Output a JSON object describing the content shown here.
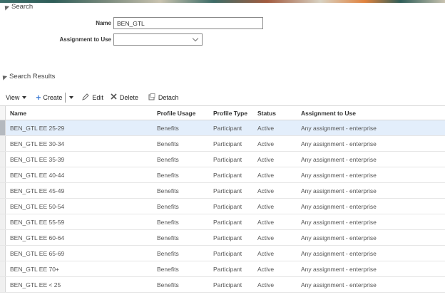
{
  "search": {
    "title": "Search",
    "name_label": "Name",
    "name_value": "BEN_GTL",
    "assignment_label": "Assignment to Use",
    "assignment_value": ""
  },
  "results": {
    "title": "Search Results",
    "toolbar": {
      "view_label": "View",
      "create_label": "Create",
      "edit_label": "Edit",
      "delete_label": "Delete",
      "detach_label": "Detach"
    },
    "columns": [
      "Name",
      "Profile Usage",
      "Profile Type",
      "Status",
      "Assignment to Use"
    ],
    "rows": [
      [
        "BEN_GTL EE 25-29",
        "Benefits",
        "Participant",
        "Active",
        "Any assignment - enterprise"
      ],
      [
        "BEN_GTL EE 30-34",
        "Benefits",
        "Participant",
        "Active",
        "Any assignment - enterprise"
      ],
      [
        "BEN_GTL EE 35-39",
        "Benefits",
        "Participant",
        "Active",
        "Any assignment - enterprise"
      ],
      [
        "BEN_GTL EE 40-44",
        "Benefits",
        "Participant",
        "Active",
        "Any assignment - enterprise"
      ],
      [
        "BEN_GTL EE 45-49",
        "Benefits",
        "Participant",
        "Active",
        "Any assignment - enterprise"
      ],
      [
        "BEN_GTL EE 50-54",
        "Benefits",
        "Participant",
        "Active",
        "Any assignment - enterprise"
      ],
      [
        "BEN_GTL EE 55-59",
        "Benefits",
        "Participant",
        "Active",
        "Any assignment - enterprise"
      ],
      [
        "BEN_GTL EE 60-64",
        "Benefits",
        "Participant",
        "Active",
        "Any assignment - enterprise"
      ],
      [
        "BEN_GTL EE 65-69",
        "Benefits",
        "Participant",
        "Active",
        "Any assignment - enterprise"
      ],
      [
        "BEN_GTL EE 70+",
        "Benefits",
        "Participant",
        "Active",
        "Any assignment - enterprise"
      ],
      [
        "BEN_GTL EE < 25",
        "Benefits",
        "Participant",
        "Active",
        "Any assignment - enterprise"
      ]
    ],
    "selected_row": 0
  },
  "icons": {
    "edit": "pencil-icon",
    "delete": "x-icon",
    "detach": "detach-icon"
  },
  "colors": {
    "selected_row_bg": "#e3eefb",
    "create_plus": "#3d7bd4"
  }
}
